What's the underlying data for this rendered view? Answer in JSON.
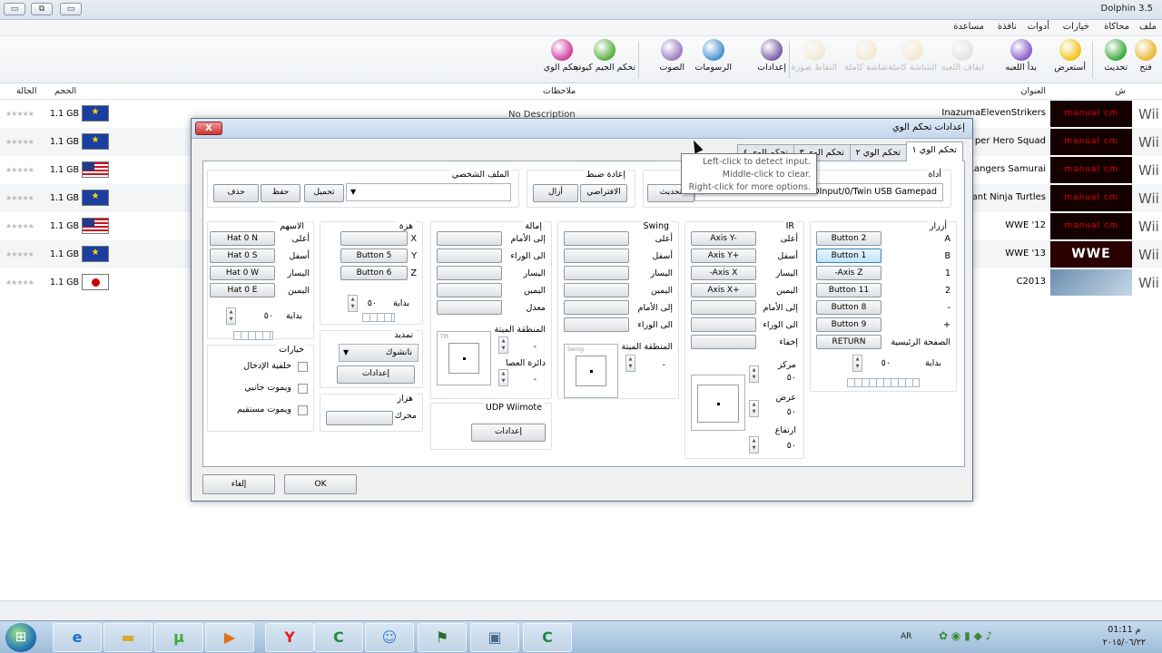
{
  "window": {
    "title": "Dolphin 3.5"
  },
  "menu": [
    "ملف",
    "محاكاة",
    "خيارات",
    "أدوات",
    "نافذة",
    "مساعدة"
  ],
  "toolbar": [
    {
      "label": "فتح",
      "icon": "folder-open-icon",
      "enabled": true,
      "color": "#e8b832"
    },
    {
      "label": "تحديث",
      "icon": "refresh-icon",
      "enabled": true,
      "color": "#3caa3c"
    },
    {
      "label": "أستعرض",
      "icon": "star-icon",
      "enabled": true,
      "color": "#f0c419"
    },
    {
      "label": "بدأ اللعبه",
      "icon": "play-icon",
      "enabled": true,
      "color": "#8a5cc8"
    },
    {
      "label": "ايقاف اللعبه",
      "icon": "pause-icon",
      "enabled": false,
      "color": "#aaaaaa"
    },
    {
      "label": "الشاشة كاملة",
      "icon": "fullscreen-icon",
      "enabled": false,
      "color": "#e8c060"
    },
    {
      "label": "شاشة كاملة",
      "icon": "screen-icon",
      "enabled": false,
      "color": "#e8c060"
    },
    {
      "label": "التقاط صورة",
      "icon": "screenshot-icon",
      "enabled": false,
      "color": "#e8c060"
    },
    {
      "label": "إعدادات",
      "icon": "wrench-icon",
      "enabled": true,
      "color": "#7a5fa8"
    },
    {
      "label": "الرسومات",
      "icon": "monitor-icon",
      "enabled": true,
      "color": "#4a8fd0"
    },
    {
      "label": "الصوت",
      "icon": "speaker-icon",
      "enabled": true,
      "color": "#9a7fc0"
    },
    {
      "label": "تحكم الجيم كيوب",
      "icon": "gamecube-pad-icon",
      "enabled": true,
      "color": "#5ab040"
    },
    {
      "label": "تحكم الوي",
      "icon": "wiimote-icon",
      "enabled": true,
      "color": "#d040a0"
    }
  ],
  "columns": {
    "platform": "ش",
    "title": "العنوان",
    "notes": "ملاحظات",
    "size": "الحجم",
    "state": "الحالة"
  },
  "games": [
    {
      "title": "InazumaElevenStrikers",
      "size": "1.1 GB",
      "flag": "eu",
      "banner": "red",
      "banner_text": "manual cm",
      "stars": "★★★★★"
    },
    {
      "title": "per Hero Squad",
      "size": "1.1 GB",
      "flag": "eu",
      "banner": "red",
      "banner_text": "manual cm",
      "stars": "★★★★★"
    },
    {
      "title": "Rangers Samurai",
      "size": "1.1 GB",
      "flag": "us",
      "banner": "red",
      "banner_text": "manual cm",
      "stars": "★★★★★"
    },
    {
      "title": "ant Ninja Turtles",
      "size": "1.1 GB",
      "flag": "eu",
      "banner": "red",
      "banner_text": "manual cm",
      "stars": "★★★★★"
    },
    {
      "title": "WWE '12",
      "size": "1.1 GB",
      "flag": "us",
      "banner": "red",
      "banner_text": "manual cm",
      "stars": "★★★★★"
    },
    {
      "title": "WWE '13",
      "size": "1.1 GB",
      "flag": "eu",
      "banner": "wwe",
      "banner_text": "WWE",
      "stars": "★★★★★"
    },
    {
      "title": "C2013",
      "size": "1.1 GB",
      "flag": "jp",
      "banner": "ani",
      "banner_text": "",
      "stars": "★★★★★"
    }
  ],
  "first_note": "No Description",
  "platform_label": "Wii",
  "dialog": {
    "title": "إعدادات تحكم الوي",
    "close": "X",
    "tabs": [
      "تحكم الوي ١",
      "تحكم الوي ٢",
      "تحكم الوي ٣",
      "تحكم الوي ٤"
    ],
    "device_label": "أداة",
    "device_value": "DInput/0/Twin USB Gamepad",
    "refresh": "تحديث",
    "reset_label": "إعادة ضبط",
    "default_btn": "الافتراضي",
    "clear_btn": "أزال",
    "profile_label": "الملف الشخصي",
    "load_btn": "تحميل",
    "save_btn": "حفظ",
    "delete_btn": "حذف",
    "buttons_group": {
      "title": "أزرار",
      "rows": [
        {
          "label": "A",
          "value": "Button 2"
        },
        {
          "label": "B",
          "value": "Button 1"
        },
        {
          "label": "1",
          "value": "-Axis Z"
        },
        {
          "label": "2",
          "value": "Button 11"
        },
        {
          "label": "-",
          "value": "Button 8"
        },
        {
          "label": "+",
          "value": "Button 9"
        },
        {
          "label": "الصفحة الرئيسية",
          "value": "RETURN"
        }
      ],
      "start": "بداية",
      "start_val": "٥٠"
    },
    "ir_group": {
      "title": "IR",
      "rows": [
        {
          "label": "أعلى",
          "value": "Axis Y-"
        },
        {
          "label": "أسفل",
          "value": "Axis Y+"
        },
        {
          "label": "اليسار",
          "value": "-Axis X"
        },
        {
          "label": "اليمين",
          "value": "Axis X+"
        },
        {
          "label": "إلى الأمام",
          "value": ""
        },
        {
          "label": "الى الوراء",
          "value": ""
        },
        {
          "label": "إخفاء",
          "value": ""
        }
      ],
      "center": "مركز",
      "center_val": "٥٠",
      "width": "عرض",
      "width_val": "٥٠",
      "height": "ارتفاع",
      "height_val": "٥٠"
    },
    "swing_group": {
      "title": "Swing",
      "rows": [
        {
          "label": "أعلى"
        },
        {
          "label": "أسفل"
        },
        {
          "label": "اليسار"
        },
        {
          "label": "اليمين"
        },
        {
          "label": "إلى الأمام"
        },
        {
          "label": "الى الوراء"
        }
      ],
      "deadzone": "المنطقة الميتة",
      "deadzone_val": "-",
      "box_label": "Swing"
    },
    "tilt_group": {
      "title": "إمالة",
      "rows": [
        {
          "label": "إلى الأمام"
        },
        {
          "label": "الى الوراء"
        },
        {
          "label": "اليسار"
        },
        {
          "label": "اليمين"
        },
        {
          "label": "معدل"
        }
      ],
      "deadzone": "المنطقة الميتة",
      "deadzone_val": "-",
      "circle": "دائرة العصا",
      "circle_val": "-",
      "box_label": "Tilt"
    },
    "shake_group": {
      "title": "هزة",
      "rows": [
        {
          "label": "X",
          "value": ""
        },
        {
          "label": "Y",
          "value": "Button 5"
        },
        {
          "label": "Z",
          "value": "Button 6"
        }
      ],
      "start": "بداية",
      "start_val": "٥٠"
    },
    "dpad_group": {
      "title": "الاسهم",
      "rows": [
        {
          "label": "أعلى",
          "value": "Hat 0 N"
        },
        {
          "label": "أسفل",
          "value": "Hat 0 S"
        },
        {
          "label": "اليسار",
          "value": "Hat 0 W"
        },
        {
          "label": "اليمين",
          "value": "Hat 0 E"
        }
      ],
      "start": "بداية",
      "start_val": "٥٠"
    },
    "extension_group": {
      "title": "تمديد",
      "value": "نانشوك",
      "settings": "إعدادات"
    },
    "options_group": {
      "title": "خيارات",
      "items": [
        "خلفية الإدخال",
        "ويموت جانبي",
        "ويموت مستقيم"
      ]
    },
    "udp_group": {
      "title": "UDP Wiimote",
      "settings": "إعدادات"
    },
    "rumble_group": {
      "title": "هزاز",
      "motor": "محرك"
    },
    "ok": "OK",
    "cancel": "إلغاء"
  },
  "tooltip": [
    "Left-click to detect input.",
    "Middle-click to clear.",
    "Right-click for more options."
  ],
  "taskbar": {
    "lang": "AR",
    "time": "01:11 م",
    "date": "٢٠١٥/٠٦/٢٢"
  }
}
